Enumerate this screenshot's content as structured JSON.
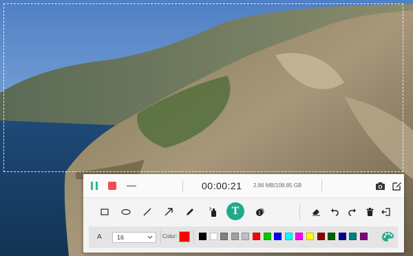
{
  "recorder": {
    "timer": "00:00:21",
    "file_size": "2.86 MB/108.85 GB"
  },
  "icons": {
    "pause": "pause-icon",
    "stop": "stop-icon",
    "minimize": "minimize-icon",
    "camera": "camera-icon",
    "edit": "edit-icon",
    "text_tool_glyph": "T"
  },
  "properties": {
    "text_letter": "A",
    "font_size": "16",
    "color_label": "Color:",
    "current_color": "#ff0000",
    "palette": [
      "#000000",
      "#ffffff",
      "#808080",
      "#a0a0a0",
      "#c0c0c0",
      "#ff0000",
      "#00cc00",
      "#0000ff",
      "#00ffff",
      "#ff00ff",
      "#ffff00",
      "#8b0000",
      "#006400",
      "#00008b",
      "#008080",
      "#800080"
    ]
  },
  "colors": {
    "accent": "#1fab89",
    "stop": "#f24d57",
    "pause": "#2dbd86"
  }
}
